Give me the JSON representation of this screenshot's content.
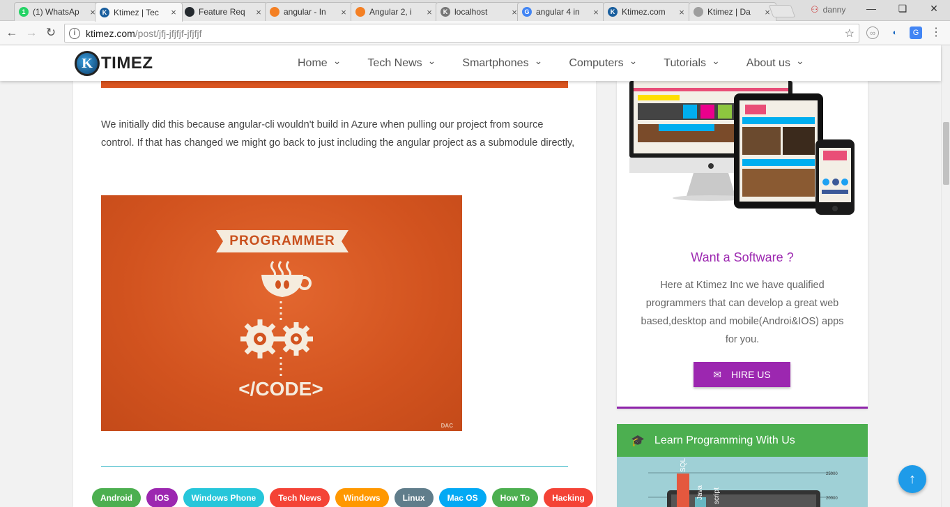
{
  "browser": {
    "tabs": [
      {
        "title": "(1) WhatsAp",
        "favicon_color": "#25d366",
        "favicon_glyph": "1"
      },
      {
        "title": "Ktimez | Tec",
        "favicon_color": "#1a5f9e",
        "favicon_glyph": "K"
      },
      {
        "title": "Feature Req",
        "favicon_color": "#24292e",
        "favicon_glyph": ""
      },
      {
        "title": "angular - In",
        "favicon_color": "#f48024",
        "favicon_glyph": ""
      },
      {
        "title": "Angular 2, i",
        "favicon_color": "#f48024",
        "favicon_glyph": ""
      },
      {
        "title": "localhost",
        "favicon_color": "#777777",
        "favicon_glyph": "K"
      },
      {
        "title": "angular 4 in",
        "favicon_color": "#4285f4",
        "favicon_glyph": "G"
      },
      {
        "title": "Ktimez.com",
        "favicon_color": "#1a5f9e",
        "favicon_glyph": "K"
      },
      {
        "title": "Ktimez | Da",
        "favicon_color": "#9e9e9e",
        "favicon_glyph": ""
      }
    ],
    "active_tab_index": 1,
    "user_name": "danny",
    "url_host": "ktimez.com",
    "url_path": "/post/jfj-jfjfjf-jfjfjf"
  },
  "site": {
    "logo_text": "TIMEZ",
    "logo_mark": "K",
    "menu": [
      {
        "label": "Home"
      },
      {
        "label": "Tech News"
      },
      {
        "label": "Smartphones"
      },
      {
        "label": "Computers"
      },
      {
        "label": "Tutorials"
      },
      {
        "label": "About us"
      }
    ]
  },
  "post": {
    "paragraph": "We initially did this because angular-cli wouldn't build in Azure when pulling our project from source control. If that has changed we might go back to just including the angular project as a submodule directly,",
    "image_top_text": "PROGRAMMER",
    "image_bottom_text": "</CODE>",
    "image_watermark": "DAC",
    "tags": [
      {
        "label": "Android",
        "color": "#4caf50"
      },
      {
        "label": "IOS",
        "color": "#9c27b0"
      },
      {
        "label": "Windows Phone",
        "color": "#26c6da"
      },
      {
        "label": "Tech News",
        "color": "#f44336"
      },
      {
        "label": "Windows",
        "color": "#ff9800"
      },
      {
        "label": "Linux",
        "color": "#607d8b"
      },
      {
        "label": "Mac OS",
        "color": "#03a9f4"
      },
      {
        "label": "How To",
        "color": "#4caf50"
      },
      {
        "label": "Hacking",
        "color": "#f44336"
      }
    ]
  },
  "sidebar": {
    "software_title": "Want a Software ?",
    "software_desc": "Here at Ktimez Inc we have qualified programmers that can develop a great web based,desktop and mobile(Androi&IOS) apps for you.",
    "hire_label": "HIRE US",
    "learn_title": "Learn Programming With Us",
    "chart_labels": [
      "SQL",
      "Java",
      "script"
    ],
    "chart_ticks": [
      "25000",
      "20000"
    ]
  },
  "colors": {
    "accent_purple": "#9c27b0",
    "accent_green": "#4caf50",
    "fab_blue": "#1e9be9",
    "banner_orange": "#d9541f"
  }
}
